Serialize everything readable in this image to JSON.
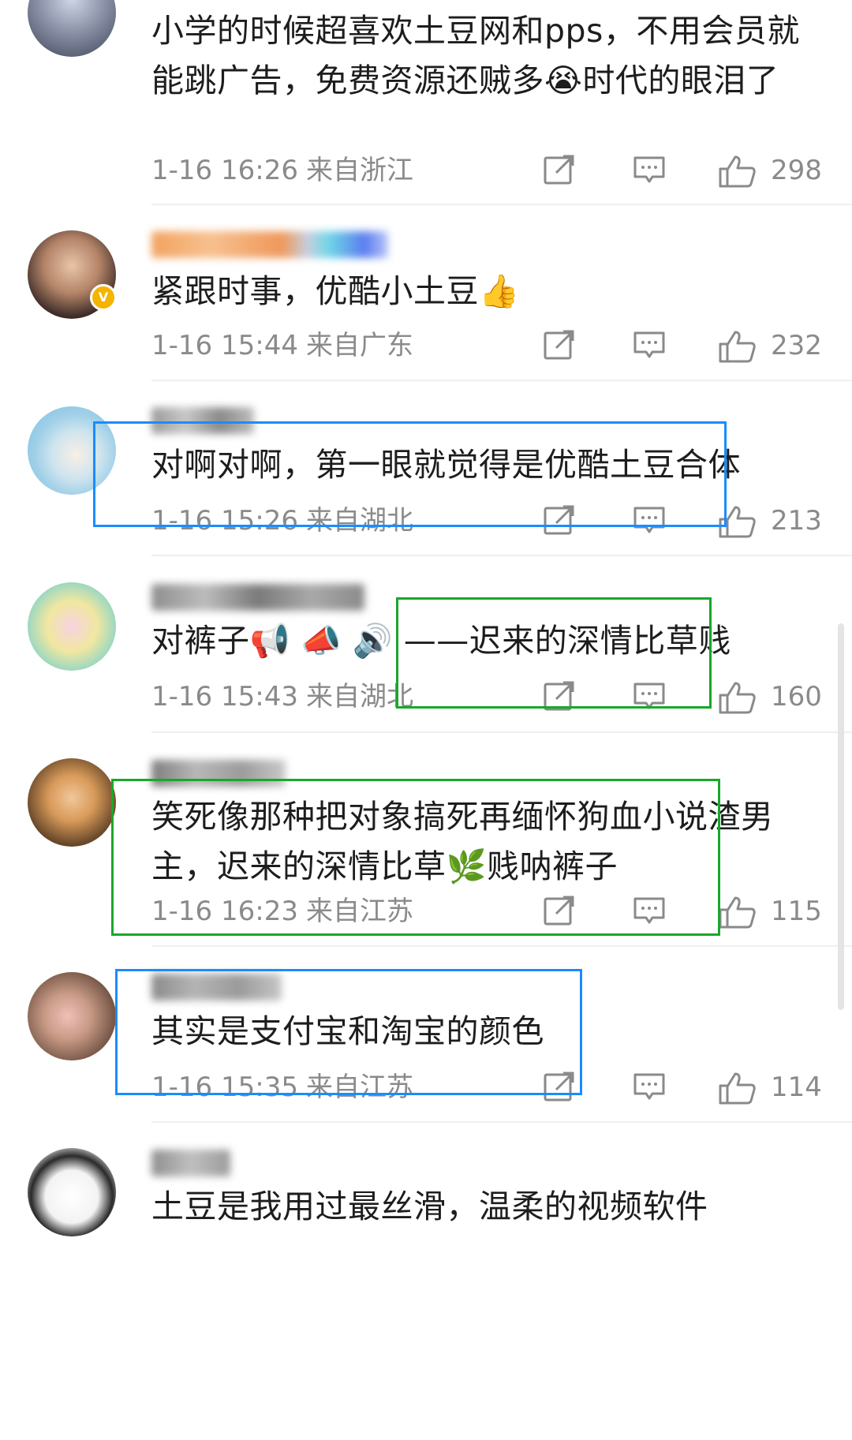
{
  "comments": [
    {
      "text": "小学的时候超喜欢土豆网和pps，不用会员就能跳广告，免费资源还贼多😭时代的眼泪了",
      "time": "1-16 16:26",
      "location": "来自浙江",
      "likes": "298"
    },
    {
      "text": "紧跟时事，优酷小土豆👍",
      "time": "1-16 15:44",
      "location": "来自广东",
      "likes": "232"
    },
    {
      "text": "对啊对啊，第一眼就觉得是优酷土豆合体",
      "time": "1-16 15:26",
      "location": "来自湖北",
      "likes": "213"
    },
    {
      "text": "对裤子📢 📣 🔊 ——迟来的深情比草贱",
      "time": "1-16 15:43",
      "location": "来自湖北",
      "likes": "160"
    },
    {
      "text": "笑死像那种把对象搞死再缅怀狗血小说渣男主，迟来的深情比草🌿贱呐裤子",
      "time": "1-16 16:23",
      "location": "来自江苏",
      "likes": "115"
    },
    {
      "text": "其实是支付宝和淘宝的颜色",
      "time": "1-16 15:35",
      "location": "来自江苏",
      "likes": "114"
    },
    {
      "text": "土豆是我用过最丝滑，温柔的视频软件",
      "time": "",
      "location": "",
      "likes": ""
    }
  ],
  "icons": {
    "share": "share-icon",
    "reply": "comment-icon",
    "like": "thumbs-up-icon",
    "verified": "verified-badge-icon"
  },
  "colors": {
    "highlight_blue": "#1a8cff",
    "highlight_green": "#18a82a",
    "meta_gray": "#8a8a8a",
    "verified_gold": "#f5b400"
  }
}
